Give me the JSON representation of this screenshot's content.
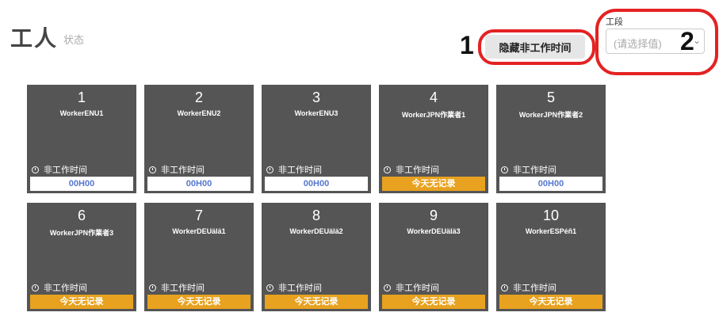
{
  "header": {
    "title": "工人",
    "subtitle": "状态",
    "hide_button_label": "隐藏非工作时间"
  },
  "segment": {
    "label": "工段",
    "placeholder": "(请选择值)"
  },
  "markers": [
    "1",
    "2"
  ],
  "workers": [
    {
      "number": "1",
      "name": "WorkerENU1",
      "status": "非工作时间",
      "bar": "00H00",
      "bar_type": "time"
    },
    {
      "number": "2",
      "name": "WorkerENU2",
      "status": "非工作时间",
      "bar": "00H00",
      "bar_type": "time"
    },
    {
      "number": "3",
      "name": "WorkerENU3",
      "status": "非工作时间",
      "bar": "00H00",
      "bar_type": "time"
    },
    {
      "number": "4",
      "name": "WorkerJPN作業者1",
      "status": "非工作时间",
      "bar": "今天无记录",
      "bar_type": "norec"
    },
    {
      "number": "5",
      "name": "WorkerJPN作業者2",
      "status": "非工作时间",
      "bar": "00H00",
      "bar_type": "time"
    },
    {
      "number": "6",
      "name": "WorkerJPN作業者3",
      "status": "非工作时间",
      "bar": "今天无记录",
      "bar_type": "norec"
    },
    {
      "number": "7",
      "name": "WorkerDEUälä1",
      "status": "非工作时间",
      "bar": "今天无记录",
      "bar_type": "norec"
    },
    {
      "number": "8",
      "name": "WorkerDEUälä2",
      "status": "非工作时间",
      "bar": "今天无记录",
      "bar_type": "norec"
    },
    {
      "number": "9",
      "name": "WorkerDEUälä3",
      "status": "非工作时间",
      "bar": "今天无记录",
      "bar_type": "norec"
    },
    {
      "number": "10",
      "name": "WorkerESPéñ1",
      "status": "非工作时间",
      "bar": "今天无记录",
      "bar_type": "norec"
    }
  ]
}
